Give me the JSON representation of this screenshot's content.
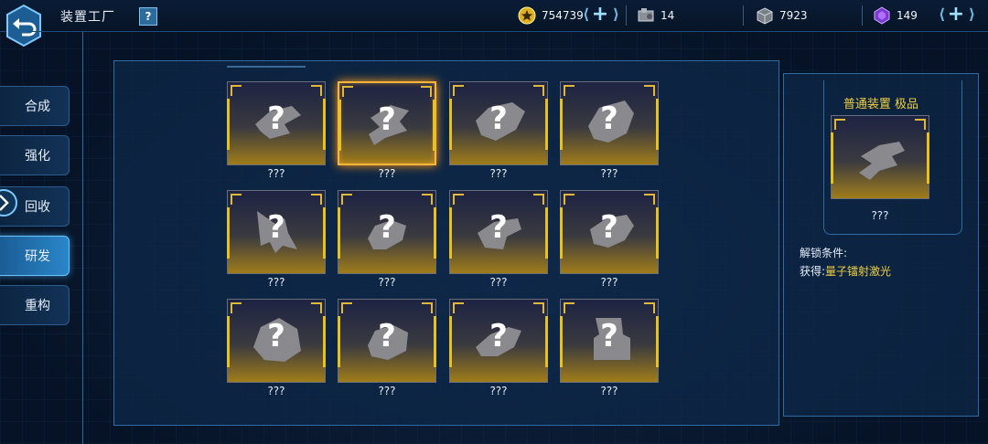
{
  "header": {
    "title": "装置工厂",
    "help_label": "?"
  },
  "resources": {
    "coins": "754739",
    "parts": "14",
    "crates": "7923",
    "gems": "149"
  },
  "nav": {
    "items": [
      {
        "label": "合成",
        "active": false
      },
      {
        "label": "强化",
        "active": false
      },
      {
        "label": "回收",
        "active": false
      },
      {
        "label": "研发",
        "active": true
      },
      {
        "label": "重构",
        "active": false
      }
    ]
  },
  "grid": {
    "items": [
      {
        "name": "???",
        "icon": "question-mark"
      },
      {
        "name": "???",
        "icon": "question-mark",
        "selected": true
      },
      {
        "name": "???",
        "icon": "question-mark"
      },
      {
        "name": "???",
        "icon": "question-mark"
      },
      {
        "name": "???",
        "icon": "question-mark"
      },
      {
        "name": "???",
        "icon": "question-mark"
      },
      {
        "name": "???",
        "icon": "question-mark"
      },
      {
        "name": "???",
        "icon": "question-mark"
      },
      {
        "name": "???",
        "icon": "question-mark"
      },
      {
        "name": "???",
        "icon": "question-mark"
      },
      {
        "name": "???",
        "icon": "question-mark"
      },
      {
        "name": "???",
        "icon": "question-mark"
      }
    ]
  },
  "detail": {
    "quality": "普通装置 极品",
    "name": "???",
    "unlock_label": "解锁条件:",
    "obtain_prefix": "获得:",
    "obtain_item": "量子镭射激光"
  },
  "colors": {
    "accent_gold": "#f0d040",
    "selected_border": "#ffb43a",
    "panel_border": "#2f6aa2"
  }
}
